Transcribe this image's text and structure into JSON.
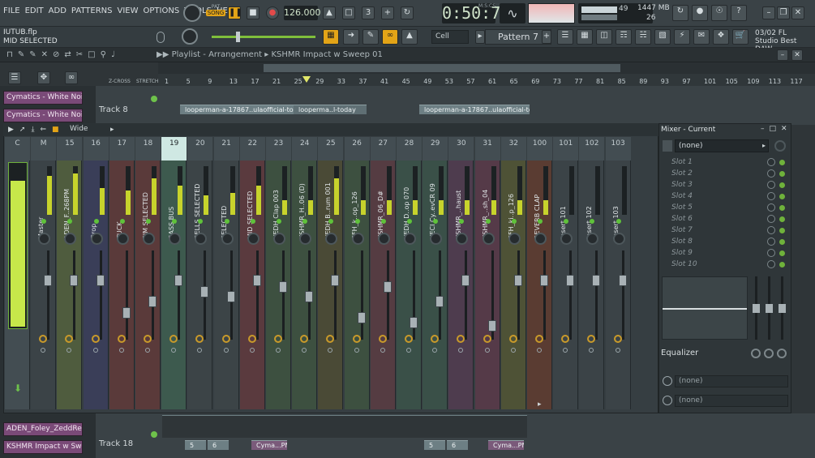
{
  "menu": [
    "FILE",
    "EDIT",
    "ADD",
    "PATTERNS",
    "VIEW",
    "OPTIONS",
    "TOOLS",
    "HELP"
  ],
  "transport": {
    "mode_pat": "PAT",
    "mode_song": "SONG",
    "tempo": "126.000",
    "time": "0:50:70",
    "time_label": "M:S:CS"
  },
  "cpu": {
    "value": "49",
    "memory": "1447 MB",
    "voices": "26"
  },
  "song": {
    "file": "IUTUB.flp",
    "hint": "MID SELECTED"
  },
  "pattern": {
    "name": "Pattern 7",
    "snap": "Cell"
  },
  "studio": {
    "line1": "03/02  FL",
    "line2": "Studio Best DAW"
  },
  "playlist": {
    "title": "Playlist - Arrangement",
    "title_sub": "KSHMR Impact w Sweep 01",
    "ruler": [
      "1",
      "5",
      "9",
      "13",
      "17",
      "21",
      "25",
      "29",
      "33",
      "37",
      "41",
      "45",
      "49",
      "53",
      "57",
      "61",
      "65",
      "69",
      "73",
      "77",
      "81",
      "85",
      "89",
      "93",
      "97",
      "101",
      "105",
      "109",
      "113",
      "117"
    ],
    "zcross": "Z-CROSS",
    "stretch": "STRETCH",
    "channels_top": [
      "Cymatics - White Noi...",
      "Cymatics - White Noi..."
    ],
    "channels_bottom": [
      "ADEN_Foley_ZeddRe...",
      "KSHMR Impact w Swe..."
    ],
    "track8": "Track 8",
    "track18": "Track 18",
    "clips": [
      "looperman-a-17867..ulaofficial-today",
      "looperma..l-today",
      "looperman-a-17867..ulaofficial-today"
    ],
    "clips_bottom": [
      "5",
      "6",
      "Cyma...PM",
      "5",
      "6",
      "Cyma...PM"
    ]
  },
  "mixer": {
    "wide": "Wide",
    "strips": [
      {
        "num": "C",
        "name": "",
        "color": "#434d52",
        "level": 0
      },
      {
        "num": "M",
        "name": "Master",
        "color": "#3b4347",
        "level": 0.8
      },
      {
        "num": "15",
        "name": "ADEN_F..268PM",
        "color": "#4f5c3e",
        "level": 0.85
      },
      {
        "num": "16",
        "name": "Drop",
        "color": "#3a3e58",
        "level": 0.55
      },
      {
        "num": "17",
        "name": "TUCK",
        "color": "#5a3a3a",
        "level": 0.5
      },
      {
        "num": "18",
        "name": "PIM SELECTED",
        "color": "#5a3a3a",
        "level": 0.75
      },
      {
        "num": "19",
        "name": "BASS BUS",
        "color": "#3d5a4e",
        "level": 0.6
      },
      {
        "num": "20",
        "name": "BELLS SELECTED",
        "color": "#3c4447",
        "level": 0.4
      },
      {
        "num": "21",
        "name": "SELECTED",
        "color": "#3c4447",
        "level": 0.45
      },
      {
        "num": "22",
        "name": "MID SELECTED",
        "color": "#5a3a3e",
        "level": 0.6
      },
      {
        "num": "23",
        "name": "VEDH Clap 003",
        "color": "#3d5040",
        "level": 0.3
      },
      {
        "num": "24",
        "name": "KSHMR_H..06 (D)",
        "color": "#3d5040",
        "level": 0.3
      },
      {
        "num": "25",
        "name": "VEDH B..rum 001",
        "color": "#4a4a36",
        "level": 0.75
      },
      {
        "num": "26",
        "name": "SFH_k..op_126",
        "color": "#3d5040",
        "level": 0.3
      },
      {
        "num": "27",
        "name": "KSHMR_06_D#",
        "color": "#553c42",
        "level": 0.3
      },
      {
        "num": "28",
        "name": "VEDH D..op 070",
        "color": "#3a5048",
        "level": 0.3
      },
      {
        "num": "29",
        "name": "VECI Cy..evCR 09",
        "color": "#3a5048",
        "level": 0.3
      },
      {
        "num": "30",
        "name": "KSHMR_..haust",
        "color": "#4e3c4e",
        "level": 0.3
      },
      {
        "num": "31",
        "name": "KSHMR_..sh_04",
        "color": "#553a48",
        "level": 0.3
      },
      {
        "num": "32",
        "name": "SFH_ki..p_126",
        "color": "#4e5236",
        "level": 0.3
      },
      {
        "num": "100",
        "name": "REVERB CLAP",
        "color": "#5a3c32",
        "level": 0.3
      },
      {
        "num": "101",
        "name": "Insert 101",
        "color": "#3b4347",
        "level": 0
      },
      {
        "num": "102",
        "name": "Insert 102",
        "color": "#3b4347",
        "level": 0
      },
      {
        "num": "103",
        "name": "Insert 103",
        "color": "#3b4347",
        "level": 0
      }
    ]
  },
  "mixer_panel": {
    "title": "Mixer - Current",
    "insert": "(none)",
    "slots": [
      "Slot 1",
      "Slot 2",
      "Slot 3",
      "Slot 4",
      "Slot 5",
      "Slot 6",
      "Slot 7",
      "Slot 8",
      "Slot 9",
      "Slot 10"
    ],
    "eq": "Equalizer",
    "none_a": "(none)",
    "none_b": "(none)"
  }
}
